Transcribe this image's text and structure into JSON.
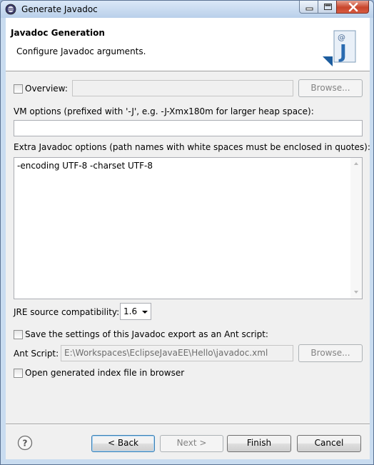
{
  "window": {
    "title": "Generate Javadoc",
    "icon": "eclipse-icon"
  },
  "banner": {
    "title": "Javadoc Generation",
    "subtitle": "Configure Javadoc arguments.",
    "icon": "javadoc-wizard-icon"
  },
  "overview": {
    "label": "Overview:",
    "checked": false,
    "value": "",
    "browse_label": "Browse..."
  },
  "vm_options": {
    "label": "VM options (prefixed with '-J', e.g. -J-Xmx180m for larger heap space):",
    "value": ""
  },
  "extra_options": {
    "label": "Extra Javadoc options (path names with white spaces must be enclosed in quotes):",
    "value": "-encoding UTF-8 -charset UTF-8"
  },
  "jre": {
    "label": "JRE source compatibility:",
    "value": "1.6"
  },
  "ant": {
    "save_label": "Save the settings of this Javadoc export as an Ant script:",
    "save_checked": false,
    "script_label": "Ant Script:",
    "script_value": "E:\\Workspaces\\EclipseJavaEE\\Hello\\javadoc.xml",
    "browse_label": "Browse..."
  },
  "open_index": {
    "label": "Open generated index file in browser",
    "checked": false
  },
  "buttons": {
    "help": "?",
    "back": "< Back",
    "next": "Next >",
    "finish": "Finish",
    "cancel": "Cancel"
  }
}
